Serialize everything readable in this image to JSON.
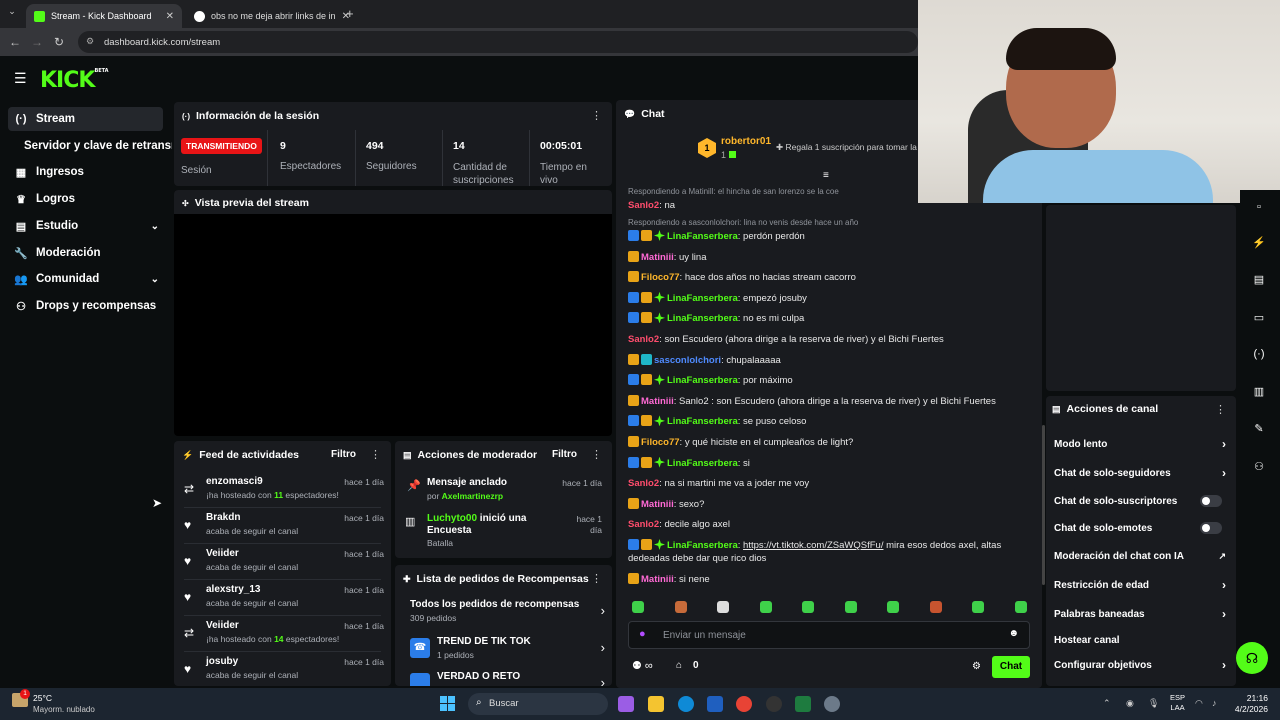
{
  "browser": {
    "tabs": [
      {
        "title": "Stream - Kick Dashboard",
        "active": true
      },
      {
        "title": "obs no me deja abrir links de in",
        "active": false
      }
    ],
    "url": "dashboard.kick.com/stream"
  },
  "header": {
    "logo": "KICK",
    "logo_badge": "BETA"
  },
  "sidebar": {
    "items": [
      {
        "label": "Stream",
        "icon": "broadcast-icon"
      },
      {
        "label": "Servidor y clave de retransmisión"
      },
      {
        "label": "Ingresos",
        "icon": "chart-icon"
      },
      {
        "label": "Logros",
        "icon": "trophy-icon"
      },
      {
        "label": "Estudio",
        "icon": "studio-icon"
      },
      {
        "label": "Moderación",
        "icon": "wrench-icon"
      },
      {
        "label": "Comunidad",
        "icon": "people-icon"
      },
      {
        "label": "Drops y recompensas",
        "icon": "drops-icon"
      }
    ]
  },
  "session": {
    "title": "Información de la sesión",
    "status": "TRANSMITIENDO",
    "status_label": "Sesión",
    "stats": [
      {
        "value": "9",
        "label": "Espectadores"
      },
      {
        "value": "494",
        "label": "Seguidores"
      },
      {
        "value": "14",
        "label": "Cantidad de suscripciones"
      },
      {
        "value": "00:05:01",
        "label": "Tiempo en vivo"
      }
    ]
  },
  "preview": {
    "title": "Vista previa del stream"
  },
  "feed": {
    "title": "Feed de actividades",
    "filter": "Filtro",
    "items": [
      {
        "name": "enzomasci9",
        "desc_pre": "¡ha hosteado con ",
        "count": "11",
        "desc_post": " espectadores!",
        "time": "hace 1 día",
        "icon": "host-icon"
      },
      {
        "name": "Brakdn",
        "desc_pre": "acaba de seguir el canal",
        "count": "",
        "desc_post": "",
        "time": "hace 1 día",
        "icon": "heart-icon"
      },
      {
        "name": "Veiider",
        "desc_pre": "acaba de seguir el canal",
        "count": "",
        "desc_post": "",
        "time": "hace 1 día",
        "icon": "heart-icon"
      },
      {
        "name": "alexstry_13",
        "desc_pre": "acaba de seguir el canal",
        "count": "",
        "desc_post": "",
        "time": "hace 1 día",
        "icon": "heart-icon"
      },
      {
        "name": "Veiider",
        "desc_pre": "¡ha hosteado con ",
        "count": "14",
        "desc_post": " espectadores!",
        "time": "hace 1 día",
        "icon": "host-icon"
      },
      {
        "name": "josuby",
        "desc_pre": "acaba de seguir el canal",
        "count": "",
        "desc_post": "",
        "time": "hace 1 día",
        "icon": "heart-icon"
      }
    ]
  },
  "modactions": {
    "title": "Acciones de moderador",
    "filter": "Filtro",
    "items": [
      {
        "title": "Mensaje anclado",
        "by": "por ",
        "user": "Axelmartinezrp",
        "time": "hace 1 día"
      },
      {
        "user": "Luchyto00",
        "title": " inició una Encuesta",
        "sub": "Batalla",
        "time": "hace 1 día"
      }
    ]
  },
  "rewards": {
    "title": "Lista de pedidos de Recompensas",
    "all_label": "Todos los pedidos de recompensas",
    "all_count": "309 pedidos",
    "items": [
      {
        "name": "TREND DE TIK TOK",
        "count": "1 pedidos"
      },
      {
        "name": "VERDAD O RETO",
        "count": ""
      }
    ]
  },
  "chat": {
    "title": "Chat",
    "top_user": "robertor01",
    "top_badge_count": "1",
    "top_rank": "1",
    "gift_text": "Regala 1 suscripción para tomar la",
    "messages": [
      {
        "reply": "Respondiendo a Matinill: el hincha de san lorenzo se la coe"
      },
      {
        "user": "Sanlo2",
        "color": "#ff4d6d",
        "text": "na",
        "badges": ""
      },
      {
        "reply": "Respondiendo a sasconlolchori: lina no venis desde hace un año"
      },
      {
        "user": "LinaFanserbera",
        "color": "#53fc18",
        "text": "perdón perdón",
        "badges": "mod-sub-vip"
      },
      {
        "user": "Matiniii",
        "color": "#ff6ad5",
        "text": "uy lina",
        "badges": "sub"
      },
      {
        "user": "Filoco77",
        "color": "#ffb72b",
        "text": "hace dos años no hacias stream cacorro",
        "badges": "sub"
      },
      {
        "user": "LinaFanserbera",
        "color": "#53fc18",
        "text": "empezó josuby",
        "badges": "mod-sub-vip"
      },
      {
        "user": "LinaFanserbera",
        "color": "#53fc18",
        "text": "no es mi culpa",
        "badges": "mod-sub-vip"
      },
      {
        "user": "Sanlo2",
        "color": "#ff4d6d",
        "text": "son Escudero (ahora dirige a la reserva de river) y el Bichi Fuertes",
        "badges": ""
      },
      {
        "user": "sasconlolchori",
        "color": "#4f8bff",
        "text": "chupalaaaaa",
        "badges": "sub-og"
      },
      {
        "user": "LinaFanserbera",
        "color": "#53fc18",
        "text": "por máximo",
        "badges": "mod-sub-vip"
      },
      {
        "user": "Matiniii",
        "color": "#ff6ad5",
        "text": "Sanlo2 : son Escudero (ahora dirige a la reserva de river) y el Bichi Fuertes",
        "badges": "sub"
      },
      {
        "user": "LinaFanserbera",
        "color": "#53fc18",
        "text": "se puso celoso",
        "badges": "mod-sub-vip"
      },
      {
        "user": "Filoco77",
        "color": "#ffb72b",
        "text": "y qué hiciste en el cumpleaños de light?",
        "badges": "sub"
      },
      {
        "user": "LinaFanserbera",
        "color": "#53fc18",
        "text": "si",
        "badges": "mod-sub-vip"
      },
      {
        "user": "Sanlo2",
        "color": "#ff4d6d",
        "text": "na si martini me va a joder me voy",
        "badges": ""
      },
      {
        "user": "Matiniii",
        "color": "#ff6ad5",
        "text": "sexo?",
        "badges": "sub"
      },
      {
        "user": "Sanlo2",
        "color": "#ff4d6d",
        "text": "decile algo axel",
        "badges": ""
      },
      {
        "user": "LinaFanserbera",
        "color": "#53fc18",
        "text_link": "https://vt.tiktok.com/ZSaWQSfFu/",
        "text": " mira esos dedos axel, altas",
        "text2": "dedeadas debe dar que rico dios",
        "badges": "mod-sub-vip"
      },
      {
        "user": "Matiniii",
        "color": "#ff6ad5",
        "text": "si nene",
        "badges": "sub"
      }
    ],
    "input_placeholder": "Enviar un mensaje",
    "bottom_count": "0",
    "send_label": "Chat"
  },
  "channel_actions": {
    "title": "Acciones de canal",
    "rows": [
      {
        "label": "Modo lento",
        "type": "arrow"
      },
      {
        "label": "Chat de solo-seguidores",
        "type": "arrow"
      },
      {
        "label": "Chat de solo-suscriptores",
        "type": "toggle"
      },
      {
        "label": "Chat de solo-emotes",
        "type": "toggle"
      },
      {
        "label": "Moderación del chat con IA",
        "type": "external"
      },
      {
        "label": "Restricción de edad",
        "type": "arrow"
      },
      {
        "label": "Palabras baneadas",
        "type": "arrow"
      },
      {
        "label": "Hostear canal",
        "type": "none"
      },
      {
        "label": "Configurar objetivos",
        "type": "arrow"
      }
    ]
  },
  "taskbar": {
    "weather_temp": "25°C",
    "weather_desc": "Mayorm. nublado",
    "weather_badge": "1",
    "search": "Buscar",
    "lang1": "ESP",
    "lang2": "LAA",
    "time": "21:16",
    "date": "4/2/2026"
  },
  "colors": {
    "accent": "#53fc18",
    "live": "#e81416",
    "panel": "#191b1f",
    "bg": "#0b0e0f"
  }
}
